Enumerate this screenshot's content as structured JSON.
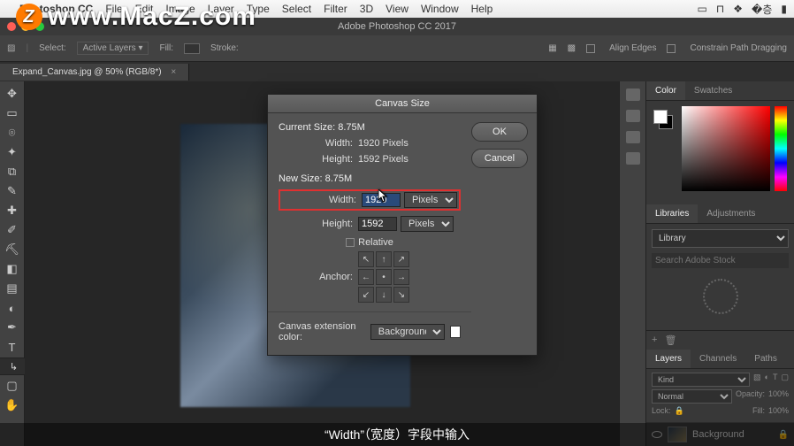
{
  "mac_menu": {
    "app": "Photoshop CC",
    "items": [
      "File",
      "Edit",
      "Image",
      "Layer",
      "Type",
      "Select",
      "Filter",
      "3D",
      "View",
      "Window",
      "Help"
    ]
  },
  "app_title": "Adobe Photoshop CC 2017",
  "options": {
    "constrain": "Constrain Path Dragging",
    "align": "Align Edges"
  },
  "doc_tab": "Expand_Canvas.jpg @ 50% (RGB/8*)",
  "panels": {
    "color_tab": "Color",
    "swatches_tab": "Swatches",
    "libraries_tab": "Libraries",
    "adjustments_tab": "Adjustments",
    "library_select": "Library",
    "search_ph": "Search Adobe Stock",
    "layers_tab": "Layers",
    "channels_tab": "Channels",
    "paths_tab": "Paths",
    "kind": "Kind",
    "blend": "Normal",
    "opacity_lbl": "Opacity:",
    "opacity_val": "100%",
    "lock_lbl": "Lock:",
    "fill_lbl": "Fill:",
    "fill_val": "100%",
    "bg_layer": "Background"
  },
  "dialog": {
    "title": "Canvas Size",
    "ok": "OK",
    "cancel": "Cancel",
    "current": "Current Size: 8.75M",
    "cw_lbl": "Width:",
    "cw_val": "1920 Pixels",
    "ch_lbl": "Height:",
    "ch_val": "1592 Pixels",
    "new": "New Size: 8.75M",
    "nw_lbl": "Width:",
    "nw_val": "1920",
    "nw_unit": "Pixels",
    "nh_lbl": "Height:",
    "nh_val": "1592",
    "nh_unit": "Pixels",
    "relative": "Relative",
    "anchor_lbl": "Anchor:",
    "ext_lbl": "Canvas extension color:",
    "ext_val": "Background"
  },
  "watermark": "www.MacZ.com",
  "subtitle": "“Width”（宽度）字段中输入"
}
